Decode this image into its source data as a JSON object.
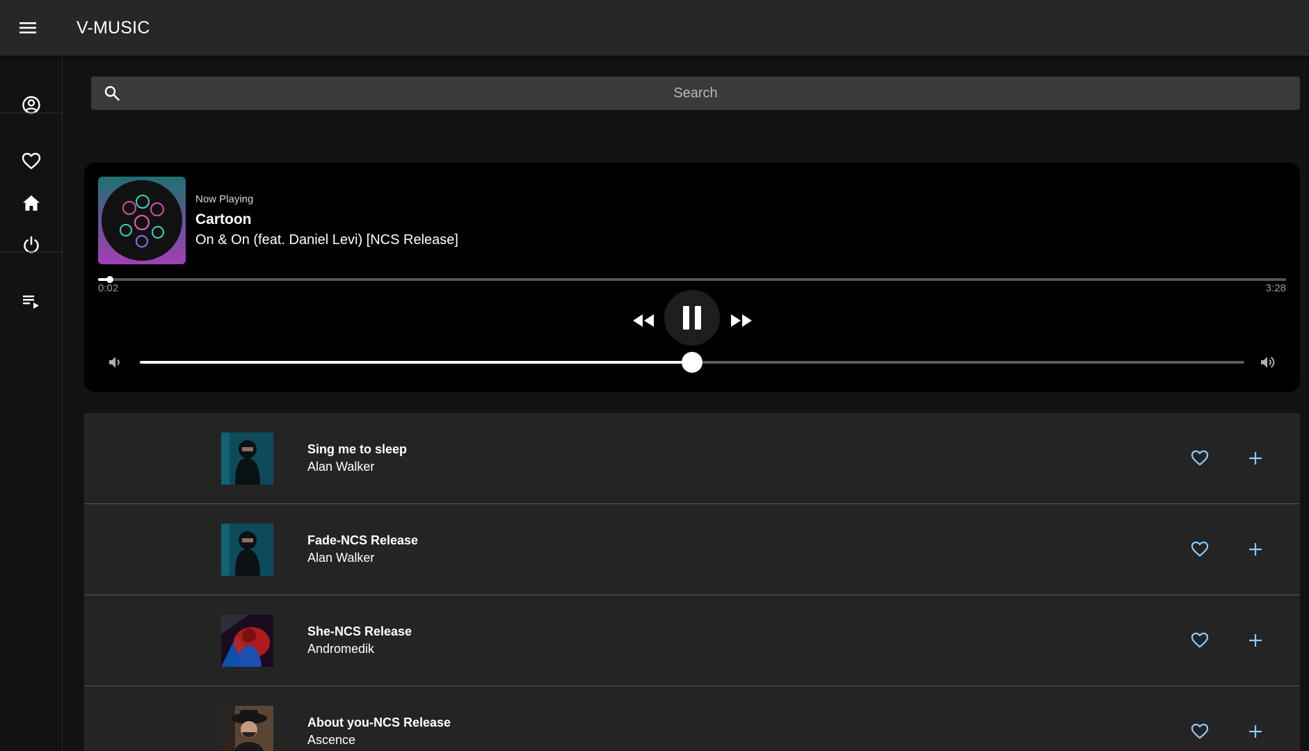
{
  "app": {
    "title": "V-MUSIC"
  },
  "icons": {
    "menu": "menu-icon",
    "profile": "account-circle-icon",
    "favorites": "heart-outline-icon",
    "home": "home-icon",
    "logout": "power-icon",
    "queue": "playlist-play-icon"
  },
  "search": {
    "placeholder": "Search",
    "value": ""
  },
  "now_playing": {
    "label": "Now Playing",
    "artist": "Cartoon",
    "track": "On & On (feat. Daniel Levi) [NCS Release]",
    "elapsed": "0:02",
    "duration": "3:28",
    "progress_fraction": 0.01,
    "volume_fraction": 0.5,
    "state": "playing"
  },
  "songs": [
    {
      "title": "Sing me to sleep",
      "artist": "Alan Walker"
    },
    {
      "title": "Fade-NCS Release",
      "artist": "Alan Walker"
    },
    {
      "title": "She-NCS Release",
      "artist": "Andromedik"
    },
    {
      "title": "About you-NCS Release",
      "artist": "Ascence"
    }
  ],
  "colors": {
    "appbar": "#272727",
    "background": "#121212",
    "player": "#000000",
    "row": "#242424",
    "accent": "#90caf9"
  }
}
